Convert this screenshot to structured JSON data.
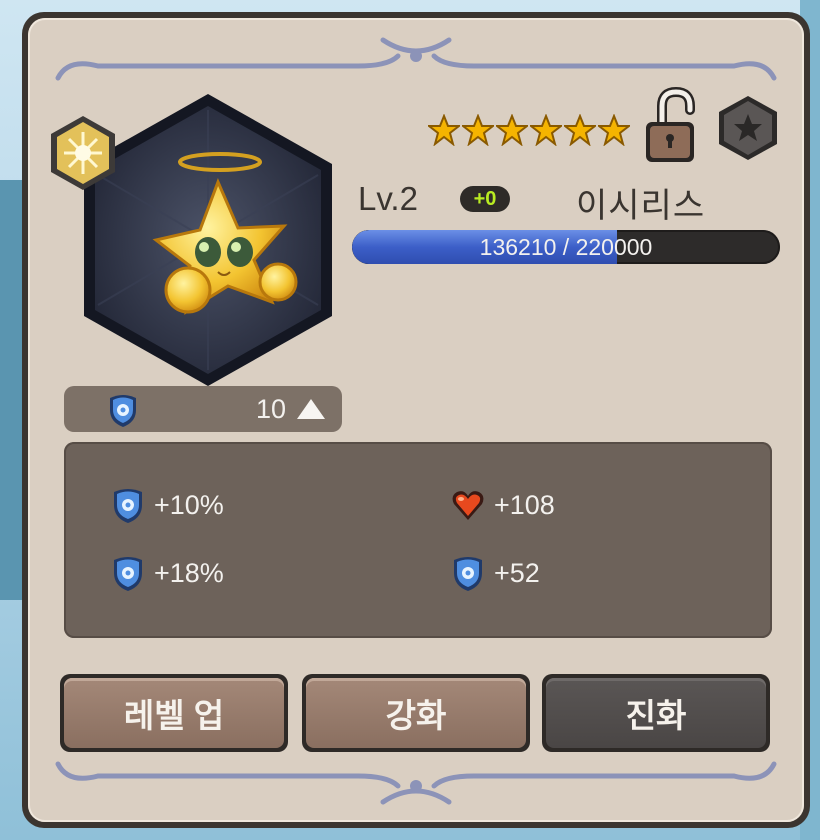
{
  "pet": {
    "level_label": "Lv.2",
    "plus_badge": "+0",
    "name": "이시리스",
    "stars": 6,
    "xp": {
      "current": 136210,
      "max": 220000,
      "text": "136210 / 220000"
    }
  },
  "level_strip": {
    "value": "10"
  },
  "stats": [
    {
      "icon": "blue-shield-icon",
      "value": "+10%"
    },
    {
      "icon": "heart-icon",
      "value": "+108"
    },
    {
      "icon": "blue-shield-icon",
      "value": "+18%"
    },
    {
      "icon": "blue-shield-icon",
      "value": "+52"
    }
  ],
  "buttons": {
    "level_up": "레벨 업",
    "enhance": "강화",
    "evolve": "진화"
  },
  "colors": {
    "xp_fill": "#3c5fc8",
    "plus_badge_text": "#b9ec22",
    "star": "#f5b400"
  }
}
